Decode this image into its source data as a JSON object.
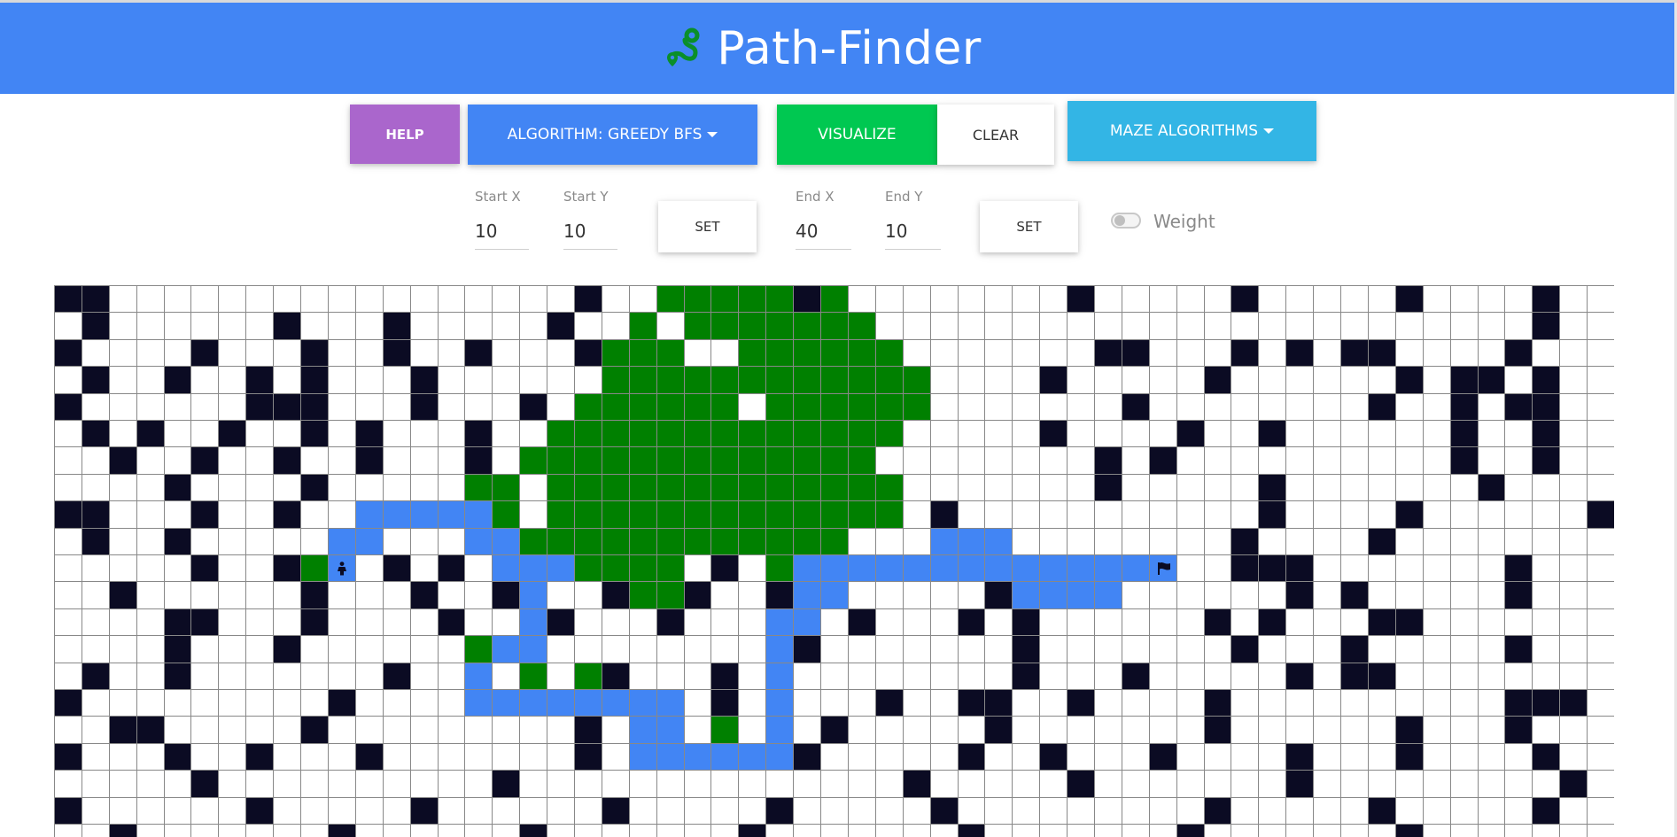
{
  "app": {
    "title": "Path-Finder",
    "brand_icon": "route-icon",
    "navbar_color": "#4285f4",
    "icon_color": "#0a8f2a"
  },
  "toolbar": {
    "help_label": "HELP",
    "algorithm_label": "ALGORITHM: GREEDY BFS",
    "visualize_label": "VISUALIZE",
    "clear_label": "CLEAR",
    "maze_label": "MAZE ALGORITHMS",
    "colors": {
      "help": "#aa66cc",
      "algorithm": "#4285f4",
      "visualize": "#00c851",
      "clear": "#ffffff",
      "maze": "#33b5e5"
    }
  },
  "coords": {
    "start_x_label": "Start X",
    "start_x_value": "10",
    "start_y_label": "Start Y",
    "start_y_value": "10",
    "start_set_label": "SET",
    "end_x_label": "End X",
    "end_x_value": "40",
    "end_y_label": "End Y",
    "end_y_value": "10",
    "end_set_label": "SET",
    "weight_label": "Weight",
    "weight_enabled": false
  },
  "grid": {
    "columns": 57,
    "visible_rows": 21,
    "colors": {
      "empty": "#ffffff",
      "wall": "#0b0b23",
      "visited": "#008000",
      "path": "#4285f4",
      "line": "#888888"
    },
    "start_icon": "person-icon",
    "end_icon": "flag-icon",
    "start_cell": [
      10,
      10
    ],
    "end_cell": [
      40,
      10
    ],
    "rows": [
      "##.................#......##.........#.....#.....#....#..",
      ".#......#...#.....#.........#.........................#..",
      "#....#...#..#..#...#.......#..........##...#.#.##....#...",
      ".#..#..#.#...#.......#.......#......#.....#......#.##.#..",
      "#......###...#...#..#...#.....#........#........#..#.##..",
      ".#.#..#..#.#...#..#.....#...........#....#..#......#..#..",
      "..#..#..#..#...#.............#........#.#..........#..#..",
      "....#....#..........#...#....#........#.....#.......#....",
      "##...#..#...........#...........#...........#....#......#",
      ".#..#......................................#....#.........",
      ".....#..#...#.#...#...#.#......#...#.......###.......#...",
      "..#......#...#..#...#..#..#.......#..........#.#.....#...",
      "....##...#....#...#...#...#..#...#.#......#.#...##.......",
      "....#...#......#...........#.......#.......#...#.....#...",
      ".#..#.......#.......#...#..........#...#.....#.##........",
      "#.........#.........#...#.#...#..##..#....#..........###.",
      "..##.....#.........#....#...#.....#.......#......#...#...",
      "#...#..#...#.......#.......#.....#..#...#....#...#....#..",
      ".....#..........#..............#.....#.......#.........#.",
      "#......#.....#......#.....#.....#.........#.....#.....#..",
      "..#.......#......#.......#.......#.......#.......#.......#"
    ]
  }
}
